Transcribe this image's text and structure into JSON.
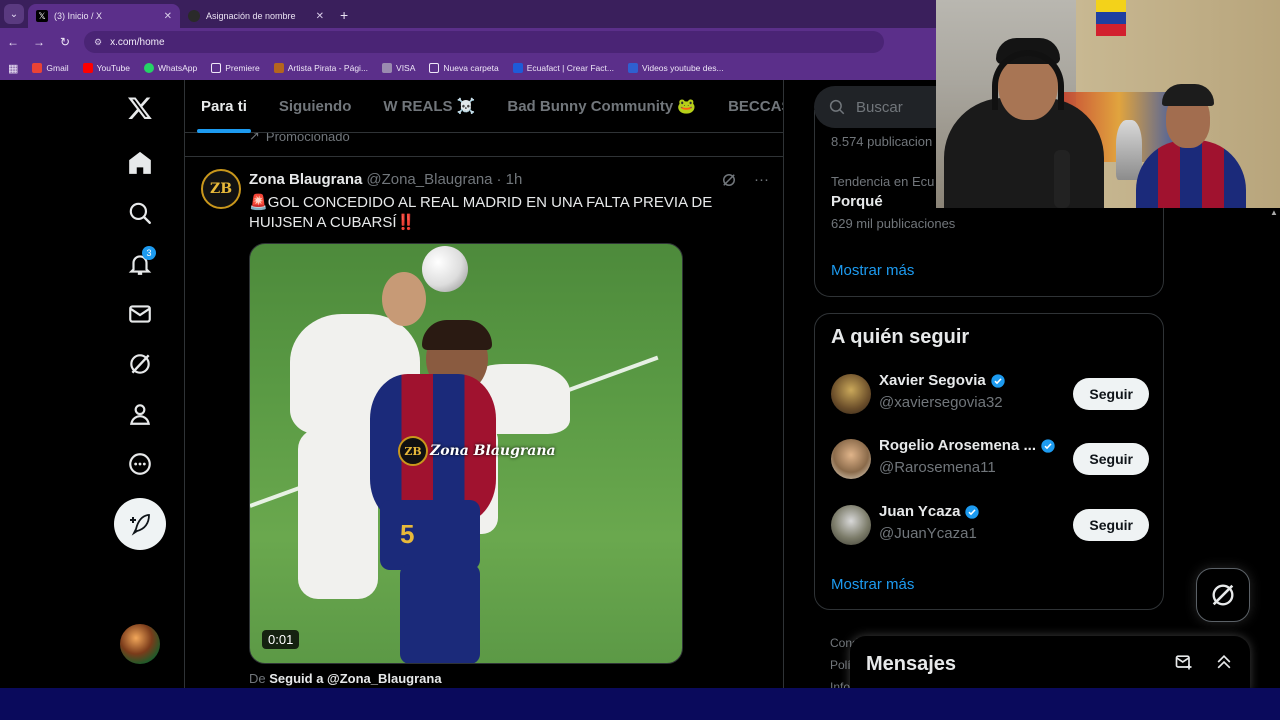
{
  "browser": {
    "tabs": [
      {
        "title": "(3) Inicio / X",
        "active": true
      },
      {
        "title": "Asignación de nombre",
        "active": false
      }
    ],
    "url": "x.com/home",
    "bookmarks": [
      "Gmail",
      "YouTube",
      "WhatsApp",
      "Premiere",
      "Artista Pirata - Pági...",
      "VISA",
      "Nueva carpeta",
      "Ecuafact | Crear Fact...",
      "Videos youtube des..."
    ]
  },
  "nav": {
    "notification_count": "3",
    "items": [
      "x-logo",
      "home",
      "explore",
      "notifications",
      "messages",
      "grok",
      "profile",
      "more"
    ]
  },
  "feed": {
    "tabs": [
      "Para ti",
      "Siguiendo",
      "W REALS ☠️",
      "Bad Bunny Community 🐸",
      "BECCASE"
    ],
    "promoted_label": "Promocionado",
    "post": {
      "avatar_text": "ZB",
      "name": "Zona Blaugrana",
      "handle": "@Zona_Blaugrana",
      "time": "· 1h",
      "text_main": "GOL CONCEDIDO AL REAL MADRID EN UNA FALTA PREVIA DE HUIJSEN A CUBARSÍ",
      "siren": "🚨",
      "bangs": "‼️",
      "watermark": "Zona Blaugrana",
      "watermark_logo": "ZB",
      "duration": "0:01",
      "follow_prefix": "De",
      "follow_text": "Seguid a @Zona_Blaugrana"
    }
  },
  "right": {
    "search_placeholder": "Buscar",
    "trend_count_1": "8.574 publicacion",
    "trend_context": "Tendencia en Ecu",
    "trend_name": "Porqué",
    "trend_count_2": "629 mil publicaciones",
    "show_more": "Mostrar más",
    "who_title": "A quién seguir",
    "who_to_follow": [
      {
        "name": "Xavier Segovia",
        "handle": "@xaviersegovia32",
        "button": "Seguir"
      },
      {
        "name": "Rogelio Arosemena ...",
        "handle": "@Rarosemena11",
        "button": "Seguir"
      },
      {
        "name": "Juan Ycaza",
        "handle": "@JuanYcaza1",
        "button": "Seguir"
      }
    ],
    "who_show_more": "Mostrar más",
    "footer_lines": [
      "Condi... ervicio · Política de Privacidad",
      "Polí...",
      "Info..."
    ],
    "messages_title": "Mensajes"
  }
}
